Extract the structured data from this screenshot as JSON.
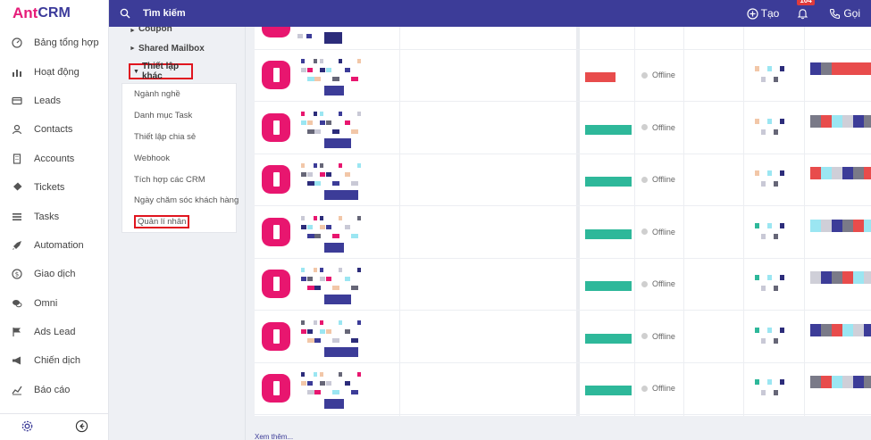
{
  "app": {
    "logo_prefix": "Ant",
    "logo_suffix": "CRM"
  },
  "sidebar": {
    "items": [
      {
        "label": "Bảng tổng hợp",
        "icon": "dashboard-icon"
      },
      {
        "label": "Hoạt động",
        "icon": "activity-icon"
      },
      {
        "label": "Leads",
        "icon": "card-icon"
      },
      {
        "label": "Contacts",
        "icon": "user-icon"
      },
      {
        "label": "Accounts",
        "icon": "building-icon"
      },
      {
        "label": "Tickets",
        "icon": "ticket-icon"
      },
      {
        "label": "Tasks",
        "icon": "list-icon"
      },
      {
        "label": "Automation",
        "icon": "rocket-icon"
      },
      {
        "label": "Giao dịch",
        "icon": "money-icon"
      },
      {
        "label": "Omni",
        "icon": "chat-icon"
      },
      {
        "label": "Ads Lead",
        "icon": "flag-icon"
      },
      {
        "label": "Chiến dịch",
        "icon": "megaphone-icon"
      },
      {
        "label": "Báo cáo",
        "icon": "chart-icon"
      }
    ]
  },
  "topbar": {
    "search_placeholder": "Tìm kiếm",
    "create_label": "Tạo",
    "notification_count": "104",
    "call_label": "Gọi"
  },
  "settings": {
    "group_coupon": "Coupon",
    "group_shared_mailbox": "Shared Mailbox",
    "group_active": "Thiết lập khác",
    "sub_items": [
      "Ngành nghề",
      "Danh mục Task",
      "Thiết lập chia sẻ",
      "Webhook",
      "Tích hợp các CRM",
      "Ngày chăm sóc khách hàng",
      "Quản lí nhân"
    ]
  },
  "table": {
    "rows": [
      {
        "presence": "Offline",
        "pill_color": "#e84c4c"
      },
      {
        "presence": "Offline",
        "pill_color": "#2eb89a"
      },
      {
        "presence": "Offline",
        "pill_color": "#2eb89a"
      },
      {
        "presence": "Offline",
        "pill_color": "#2eb89a"
      },
      {
        "presence": "Offline",
        "pill_color": "#2eb89a"
      },
      {
        "presence": "Offline",
        "pill_color": "#2eb89a"
      },
      {
        "presence": "Offline",
        "pill_color": "#2eb89a"
      }
    ]
  },
  "footer": {
    "see_more": "Xem thêm..."
  },
  "colors": {
    "brand": "#3c3c98",
    "accent": "#e8166f",
    "highlight_border": "#e0151f"
  }
}
